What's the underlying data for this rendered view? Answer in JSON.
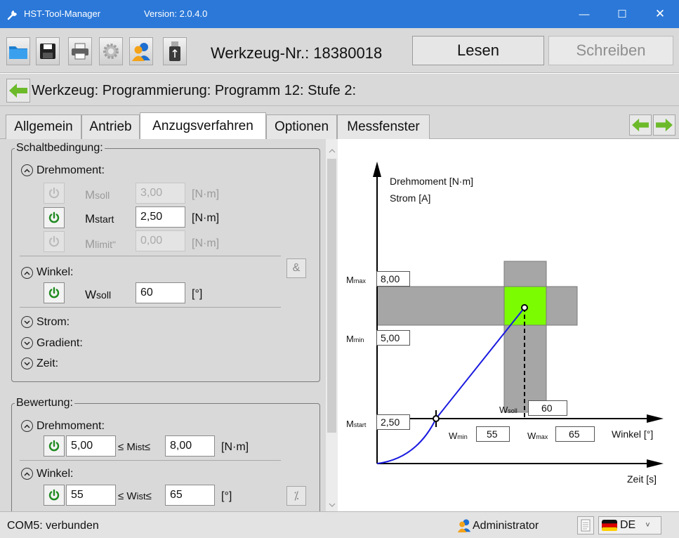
{
  "window": {
    "title": "HST-Tool-Manager",
    "version": "Version: 2.0.4.0"
  },
  "toolbar": {
    "tool_no": "Werkzeug-Nr.: 18380018",
    "read_label": "Lesen",
    "write_label": "Schreiben"
  },
  "breadcrumb": "Werkzeug: Programmierung: Programm 12: Stufe 2:",
  "tabs": [
    "Allgemein",
    "Antrieb",
    "Anzugsverfahren",
    "Optionen",
    "Messfenster"
  ],
  "active_tab": "Anzugsverfahren",
  "schalt": {
    "legend": "Schaltbedingung:",
    "drehmoment_label": "Drehmoment:",
    "msoll": {
      "label": "M",
      "sub": "soll",
      "value": "3,00",
      "unit": "[N·m]"
    },
    "mstart": {
      "label": "M",
      "sub": "start",
      "value": "2,50",
      "unit": "[N·m]"
    },
    "mlimit": {
      "label": "M",
      "sub": "limit\"",
      "value": "0,00",
      "unit": "[N·m]"
    },
    "and_symbol": "&",
    "winkel_label": "Winkel:",
    "wsoll": {
      "label": "W",
      "sub": "soll",
      "value": "60",
      "unit": "[°]"
    },
    "strom_label": "Strom:",
    "gradient_label": "Gradient:",
    "zeit_label": "Zeit:"
  },
  "bewertung": {
    "legend": "Bewertung:",
    "drehmoment_label": "Drehmoment:",
    "m_min": "5,00",
    "m_mid_a": "≤ M",
    "m_mid_sub": "ist",
    "m_mid_b": "≤",
    "m_max": "8,00",
    "m_unit": "[N·m]",
    "winkel_label": "Winkel:",
    "w_min": "55",
    "w_mid_a": "≤ W",
    "w_mid_sub": "ist",
    "w_mid_b": "≤",
    "w_max": "65",
    "w_unit": "[°]",
    "percent_symbol": "⁒"
  },
  "diagram": {
    "y_label_1": "Drehmoment [N·m]",
    "y_label_2": "Strom [A]",
    "x_label_winkel": "Winkel [°]",
    "x_label_zeit": "Zeit [s]",
    "mmax_label": "M",
    "mmax_sub": "max",
    "mmax_value": "8,00",
    "mmin_label": "M",
    "mmin_sub": "min",
    "mmin_value": "5,00",
    "mstart_label": "M",
    "mstart_sub": "start",
    "mstart_value": "2,50",
    "wmin_label": "W",
    "wmin_sub": "min",
    "wmin_value": "55",
    "wmax_label": "W",
    "wmax_sub": "max",
    "wmax_value": "65",
    "wsoll_label": "W",
    "wsoll_sub": "soll",
    "wsoll_value": "60"
  },
  "status": {
    "connection": "COM5: verbunden",
    "user": "Administrator",
    "language": "DE"
  },
  "colors": {
    "titlebar": "#2b78d8",
    "power_on": "#1f8a1f",
    "curve": "#1a1ae0",
    "target_zone": "#7cfc00"
  }
}
